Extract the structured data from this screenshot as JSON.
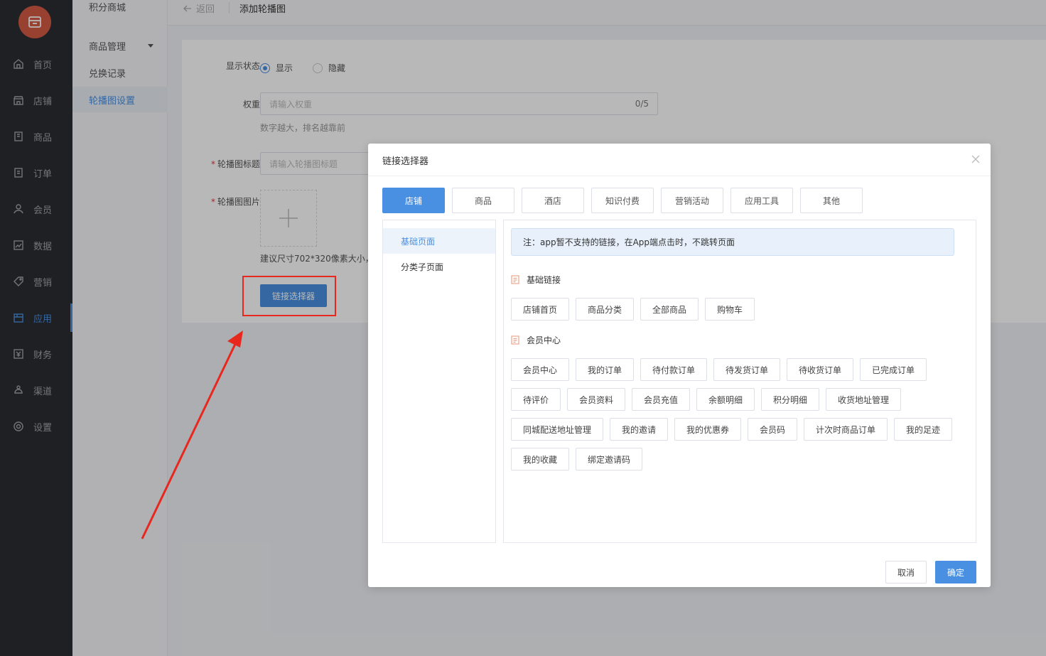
{
  "sidebar": {
    "items": [
      {
        "label": "首页",
        "icon": "home-icon"
      },
      {
        "label": "店铺",
        "icon": "shop-icon"
      },
      {
        "label": "商品",
        "icon": "goods-icon"
      },
      {
        "label": "订单",
        "icon": "order-icon"
      },
      {
        "label": "会员",
        "icon": "member-icon"
      },
      {
        "label": "数据",
        "icon": "chart-icon"
      },
      {
        "label": "营销",
        "icon": "tag-icon"
      },
      {
        "label": "应用",
        "icon": "app-icon",
        "active": true
      },
      {
        "label": "财务",
        "icon": "finance-icon"
      },
      {
        "label": "渠道",
        "icon": "channel-icon"
      },
      {
        "label": "设置",
        "icon": "gear-icon"
      }
    ]
  },
  "subsidebar": {
    "title": "积分商城",
    "items": [
      {
        "label": "商品管理"
      },
      {
        "label": "兑换记录"
      },
      {
        "label": "轮播图设置",
        "active": true
      }
    ]
  },
  "topbar": {
    "back_label": "返回",
    "page_title": "添加轮播图"
  },
  "form": {
    "display_status_label": "显示状态",
    "show_label": "显示",
    "hide_label": "隐藏",
    "weight_label": "权重",
    "weight_placeholder": "请输入权重",
    "weight_count": "0/5",
    "weight_hint": "数字越大，排名越靠前",
    "title_label": "轮播图标题",
    "title_placeholder": "请输入轮播图标题",
    "image_label": "轮播图图片",
    "image_hint": "建议尺寸702*320像素大小，",
    "link_button": "链接选择器"
  },
  "modal": {
    "title": "链接选择器",
    "tabs": [
      "店铺",
      "商品",
      "酒店",
      "知识付费",
      "营销活动",
      "应用工具",
      "其他"
    ],
    "left_items": [
      "基础页面",
      "分类子页面"
    ],
    "notice": "注：app暂不支持的链接，在App端点击时，不跳转页面",
    "section_basic": "基础链接",
    "basic_links": [
      "店铺首页",
      "商品分类",
      "全部商品",
      "购物车"
    ],
    "section_member": "会员中心",
    "member_links": [
      "会员中心",
      "我的订单",
      "待付款订单",
      "待发货订单",
      "待收货订单",
      "已完成订单",
      "待评价",
      "会员资料",
      "会员充值",
      "余额明细",
      "积分明细",
      "收货地址管理",
      "同城配送地址管理",
      "我的邀请",
      "我的优惠券",
      "会员码",
      "计次时商品订单",
      "我的足迹",
      "我的收藏",
      "绑定邀请码"
    ],
    "cancel_label": "取消",
    "ok_label": "确定"
  },
  "colors": {
    "primary": "#4a90e2",
    "sidebar_bg": "#2b2d32",
    "logo_bg": "#d55a43",
    "highlight_red": "#e8271e"
  }
}
